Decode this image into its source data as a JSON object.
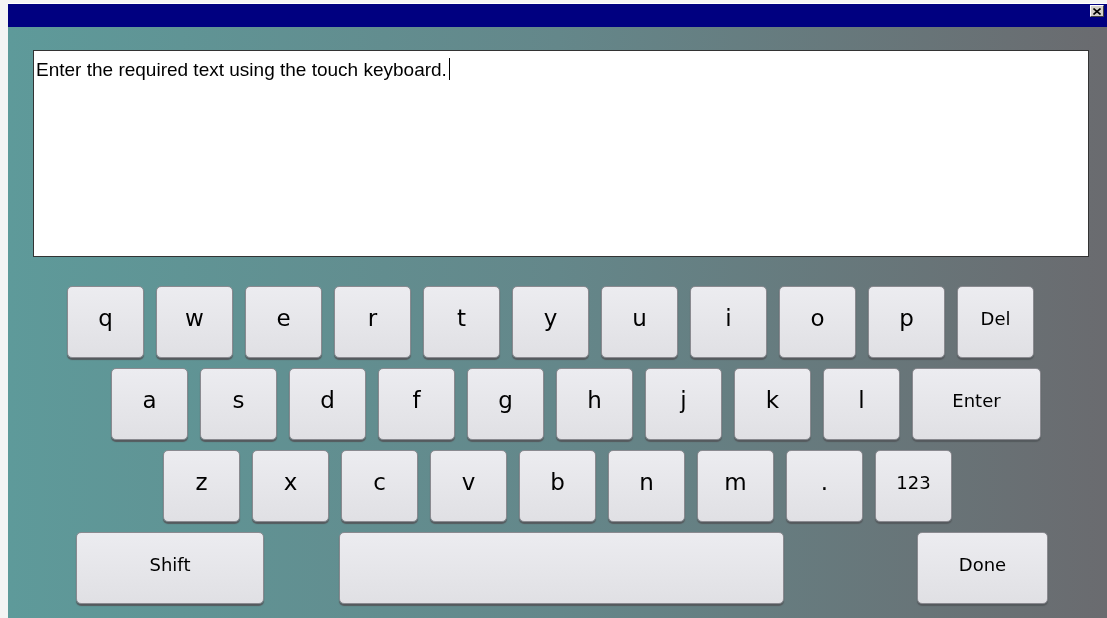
{
  "window": {
    "close_button": {
      "kind": "icon"
    }
  },
  "text_field": {
    "value": "Enter the required text using the touch keyboard."
  },
  "keyboard": {
    "rows": [
      {
        "keys": [
          {
            "label": "q",
            "kind": "char"
          },
          {
            "label": "w",
            "kind": "char"
          },
          {
            "label": "e",
            "kind": "char"
          },
          {
            "label": "r",
            "kind": "char"
          },
          {
            "label": "t",
            "kind": "char"
          },
          {
            "label": "y",
            "kind": "char"
          },
          {
            "label": "u",
            "kind": "char"
          },
          {
            "label": "i",
            "kind": "char"
          },
          {
            "label": "o",
            "kind": "char"
          },
          {
            "label": "p",
            "kind": "char"
          },
          {
            "label": "Del",
            "kind": "small"
          }
        ]
      },
      {
        "keys": [
          {
            "label": "a",
            "kind": "char"
          },
          {
            "label": "s",
            "kind": "char"
          },
          {
            "label": "d",
            "kind": "char"
          },
          {
            "label": "f",
            "kind": "char"
          },
          {
            "label": "g",
            "kind": "char"
          },
          {
            "label": "h",
            "kind": "char"
          },
          {
            "label": "j",
            "kind": "char"
          },
          {
            "label": "k",
            "kind": "char"
          },
          {
            "label": "l",
            "kind": "char"
          },
          {
            "label": "Enter",
            "kind": "wide"
          }
        ]
      },
      {
        "keys": [
          {
            "label": "z",
            "kind": "char"
          },
          {
            "label": "x",
            "kind": "char"
          },
          {
            "label": "c",
            "kind": "char"
          },
          {
            "label": "v",
            "kind": "char"
          },
          {
            "label": "b",
            "kind": "char"
          },
          {
            "label": "n",
            "kind": "char"
          },
          {
            "label": "m",
            "kind": "char"
          },
          {
            "label": ".",
            "kind": "char"
          },
          {
            "label": "123",
            "kind": "small"
          }
        ]
      },
      {
        "keys": [
          {
            "label": "Shift",
            "kind": "shift"
          },
          {
            "kind": "space"
          },
          {
            "label": "Done",
            "kind": "done"
          }
        ]
      }
    ]
  }
}
